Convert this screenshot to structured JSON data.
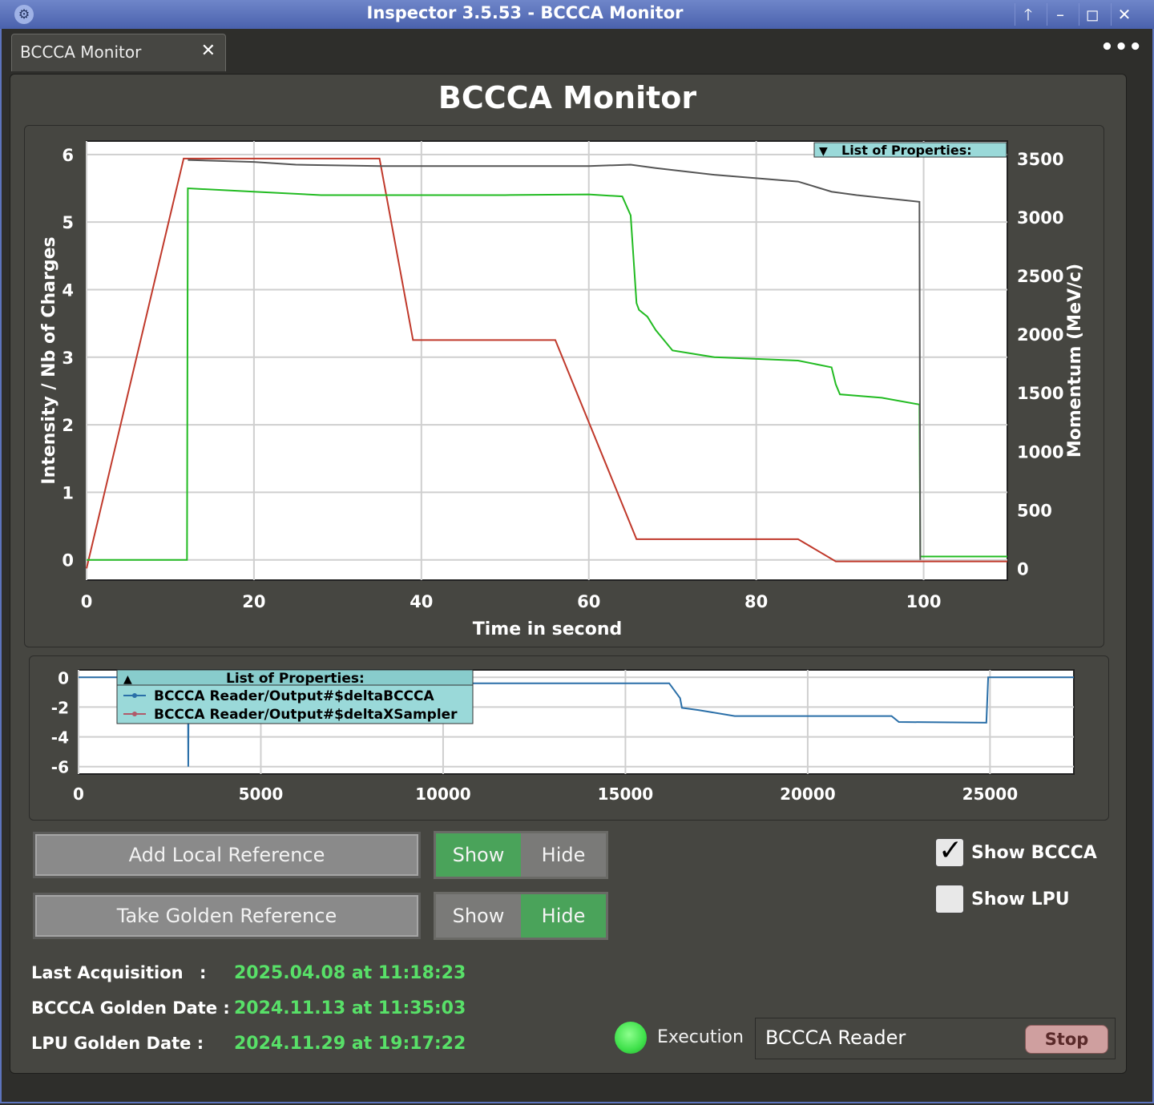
{
  "window": {
    "title": "Inspector 3.5.53 - BCCCA Monitor",
    "app_icon": "inspector-logo-icon",
    "controls": [
      "arrow-up-icon",
      "minimize-icon",
      "maximize-icon",
      "close-icon"
    ],
    "controls_glyphs": {
      "up": "🡑",
      "min": "–",
      "max": "◻",
      "close": "✕"
    }
  },
  "tab": {
    "label": "BCCCA Monitor",
    "close": "✕"
  },
  "more_menu": "•••",
  "page_title": "BCCCA Monitor",
  "colors": {
    "green_on": "#4aa35a",
    "value_green": "#58e068",
    "red_series": "#c0392b",
    "green_series": "#22bb22",
    "gray_series": "#555555",
    "blue_series": "#2a6fa8"
  },
  "chart_data": [
    {
      "type": "line",
      "title": "",
      "xlabel": "Time in second",
      "ylabel": "Intensity / Nb of Charges",
      "y2label": "Momentum (MeV/c)",
      "xlim": [
        0,
        110
      ],
      "ylim": [
        -0.3,
        6.2
      ],
      "y2lim": [
        -100,
        3650
      ],
      "xticks": [
        0,
        20,
        40,
        60,
        80,
        100
      ],
      "yticks": [
        0,
        1,
        2,
        3,
        4,
        5,
        6
      ],
      "y2ticks": [
        0,
        500,
        1000,
        1500,
        2000,
        2500,
        3000,
        3500
      ],
      "grid": true,
      "legend": {
        "title": "List of Properties:",
        "placement": "top-right",
        "collapsed": true
      },
      "series": [
        {
          "axis": "y2",
          "x": [
            0,
            11.6,
            35,
            39,
            56,
            65.7,
            85,
            89.5,
            100,
            110
          ],
          "y": [
            0,
            3500,
            3500,
            1950,
            1950,
            250,
            250,
            60,
            60,
            60
          ]
        },
        {
          "axis": "y",
          "x": [
            0,
            12,
            12.1,
            20,
            28,
            50,
            60,
            64,
            65,
            65.7,
            66,
            67,
            68,
            70,
            75,
            85,
            89,
            89.5,
            90,
            95,
            99.5,
            99.6,
            100,
            110
          ],
          "y": [
            0,
            0,
            5.5,
            5.45,
            5.4,
            5.4,
            5.41,
            5.38,
            5.1,
            3.8,
            3.7,
            3.6,
            3.4,
            3.1,
            3.0,
            2.95,
            2.85,
            2.6,
            2.45,
            2.4,
            2.3,
            0.05,
            0.05,
            0.05
          ]
        },
        {
          "axis": "y",
          "x": [
            12.1,
            20,
            25,
            35,
            40,
            50,
            60,
            65,
            68,
            75,
            85,
            89,
            92,
            99.5,
            99.6
          ],
          "y": [
            5.92,
            5.89,
            5.85,
            5.83,
            5.83,
            5.83,
            5.83,
            5.85,
            5.8,
            5.7,
            5.6,
            5.45,
            5.4,
            5.3,
            0
          ]
        }
      ]
    },
    {
      "type": "line",
      "title": "",
      "xlabel": "",
      "ylabel": "",
      "xlim": [
        0,
        27300
      ],
      "ylim": [
        -6.5,
        0.5
      ],
      "xticks": [
        0,
        5000,
        10000,
        15000,
        20000,
        25000
      ],
      "yticks": [
        0,
        -2,
        -4,
        -6
      ],
      "grid": true,
      "legend": {
        "title": "List of Properties:",
        "placement": "top-left",
        "entries": [
          {
            "name": "BCCCA Reader/Output#$deltaBCCCA",
            "color": "#2a6fa8"
          },
          {
            "name": "BCCCA Reader/Output#$deltaXSampler",
            "color": "#b05a6a"
          }
        ]
      },
      "series": [
        {
          "name": "BCCCA Reader/Output#$deltaBCCCA",
          "x": [
            0,
            3000,
            3010,
            3020,
            16200,
            16500,
            16550,
            17000,
            18000,
            22300,
            22500,
            24900,
            24950,
            27300
          ],
          "y": [
            0,
            0,
            -6,
            -0.4,
            -0.4,
            -1.4,
            -2.05,
            -2.2,
            -2.6,
            -2.6,
            -3.0,
            -3.05,
            0,
            0
          ]
        }
      ]
    }
  ],
  "buttons": {
    "add_local_reference": "Add Local Reference",
    "take_golden_reference": "Take Golden Reference"
  },
  "toggles": {
    "local": {
      "show": "Show",
      "hide": "Hide",
      "selected": "Show"
    },
    "golden": {
      "show": "Show",
      "hide": "Hide",
      "selected": "Hide"
    }
  },
  "checkboxes": {
    "show_bccca": {
      "label": "Show BCCCA",
      "checked": true,
      "mark": "✓"
    },
    "show_lpu": {
      "label": "Show LPU",
      "checked": false
    }
  },
  "info": {
    "last_acquisition_label": "Last Acquisition",
    "last_acquisition_sep": ":",
    "last_acquisition_value": "2025.04.08 at 11:18:23",
    "bccca_golden_label": "BCCCA Golden Date :",
    "bccca_golden_value": "2024.11.13 at 11:35:03",
    "lpu_golden_label": "LPU Golden Date :",
    "lpu_golden_value": "2024.11.29 at 19:17:22"
  },
  "execution": {
    "label": "Execution",
    "reader": "BCCCA Reader",
    "stop": "Stop"
  }
}
